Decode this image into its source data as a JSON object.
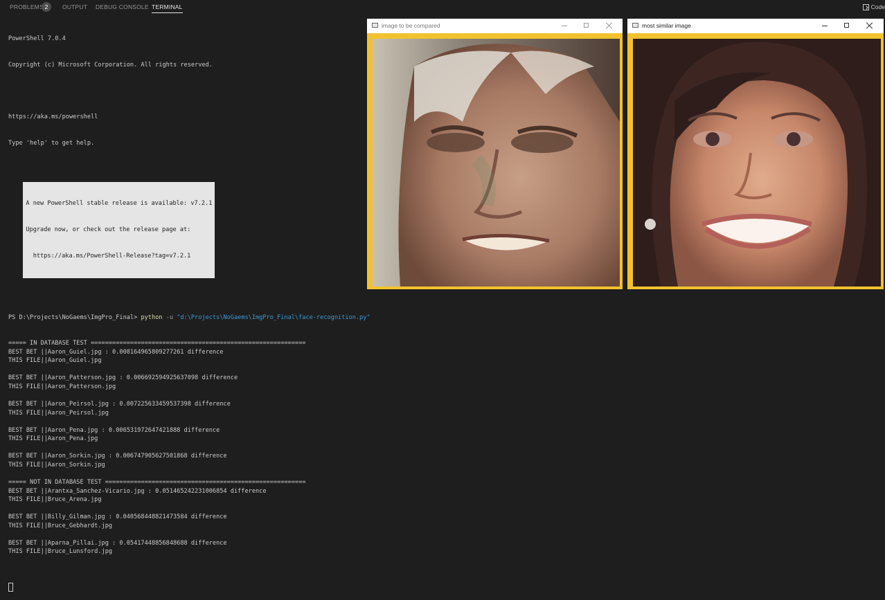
{
  "panel_tabs": [
    {
      "label": "PROBLEMS",
      "badge": "2"
    },
    {
      "label": "OUTPUT"
    },
    {
      "label": "DEBUG CONSOLE"
    },
    {
      "label": "TERMINAL",
      "active": true
    }
  ],
  "code_button": {
    "label": "Code",
    "icon": "split-terminal-icon"
  },
  "terminal": {
    "header": [
      "PowerShell 7.0.4",
      "Copyright (c) Microsoft Corporation. All rights reserved.",
      "",
      "https://aka.ms/powershell",
      "Type 'help' to get help.",
      ""
    ],
    "notice": [
      "A new PowerShell stable release is available: v7.2.1",
      "Upgrade now, or check out the release page at:",
      "  https://aka.ms/PowerShell-Release?tag=v7.2.1"
    ],
    "prompt": "PS D:\\Projects\\NoGaems\\ImgPro_Final> ",
    "command": "python",
    "command_flag": " -u ",
    "command_arg": "\"d:\\Projects\\NoGaems\\ImgPro_Final\\face-recognition.py\"",
    "output": [
      "===== IN DATABASE TEST ============================================================",
      "BEST BET ||Aaron_Guiel.jpg : 0.008164965809277261 difference",
      "THIS FILE||Aaron_Guiel.jpg",
      "",
      "BEST BET ||Aaron_Patterson.jpg : 0.006692594925637098 difference",
      "THIS FILE||Aaron_Patterson.jpg",
      "",
      "BEST BET ||Aaron_Peirsol.jpg : 0.007225633459537398 difference",
      "THIS FILE||Aaron_Peirsol.jpg",
      "",
      "BEST BET ||Aaron_Pena.jpg : 0.006531972647421888 difference",
      "THIS FILE||Aaron_Pena.jpg",
      "",
      "BEST BET ||Aaron_Sorkin.jpg : 0.006747905627501868 difference",
      "THIS FILE||Aaron_Sorkin.jpg",
      "",
      "===== NOT IN DATABASE TEST ========================================================",
      "BEST BET ||Arantxa_Sanchez-Vicario.jpg : 0.051465242231006854 difference",
      "THIS FILE||Bruce_Arena.jpg",
      "",
      "BEST BET ||Billy_Gilman.jpg : 0.040568448821473584 difference",
      "THIS FILE||Bruce_Gebhardt.jpg",
      "",
      "BEST BET ||Aparna_Pillai.jpg : 0.05417448856848688 difference",
      "THIS FILE||Bruce_Lunsford.jpg",
      ""
    ]
  },
  "windows": [
    {
      "title": "image to be compared",
      "image": "face-photo-older-man"
    },
    {
      "title": "most similar image",
      "image": "face-photo-smiling-woman"
    }
  ],
  "colors": {
    "background": "#1e1e1e",
    "text": "#cccccc",
    "image_border": "#f2c22e",
    "command_keyword": "#dcdcaa",
    "command_string": "#3b9ad6"
  }
}
